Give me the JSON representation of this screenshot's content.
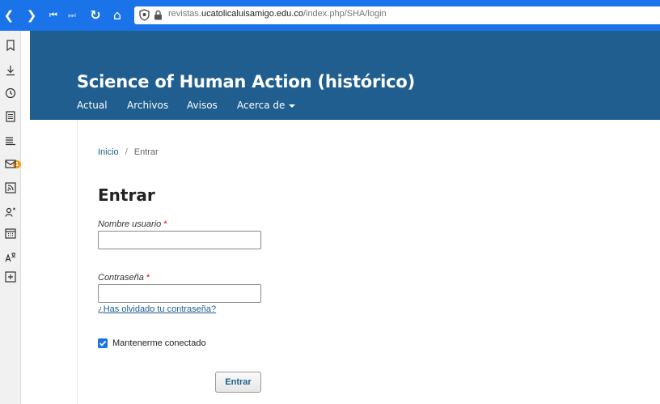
{
  "browser": {
    "nav": {
      "back": "❮",
      "forward": "❯",
      "first": "⏮",
      "last": "⏭",
      "reload": "↻",
      "home": "⌂"
    },
    "url_prefix": "revistas.",
    "url_host": "ucatolicaluisamigo.edu.co",
    "url_path": "/index.php/SHA/login",
    "accent_color": "#1a73e8"
  },
  "sidebar": {
    "icons": [
      "bookmark-icon",
      "download-icon",
      "history-icon",
      "notes-icon",
      "feed-icon",
      "mail-icon",
      "rss-icon",
      "contacts-icon",
      "calendar-icon",
      "translate-icon",
      "add-panel-icon"
    ],
    "badge_count": "1"
  },
  "site": {
    "title": "Science of Human Action (histórico)",
    "header_color": "#1f5e8e",
    "nav": {
      "current": "Actual",
      "archives": "Archivos",
      "notices": "Avisos",
      "about": "Acerca de"
    }
  },
  "breadcrumb": {
    "home": "Inicio",
    "separator": "/",
    "current": "Entrar"
  },
  "login": {
    "title": "Entrar",
    "username_label": "Nombre usuario",
    "password_label": "Contraseña",
    "required_mark": "*",
    "username_value": "",
    "password_value": "",
    "forgot_link": "¿Has olvidado tu contraseña?",
    "remember_label": "Mantenerme conectado",
    "remember_checked": true,
    "submit_label": "Entrar"
  }
}
